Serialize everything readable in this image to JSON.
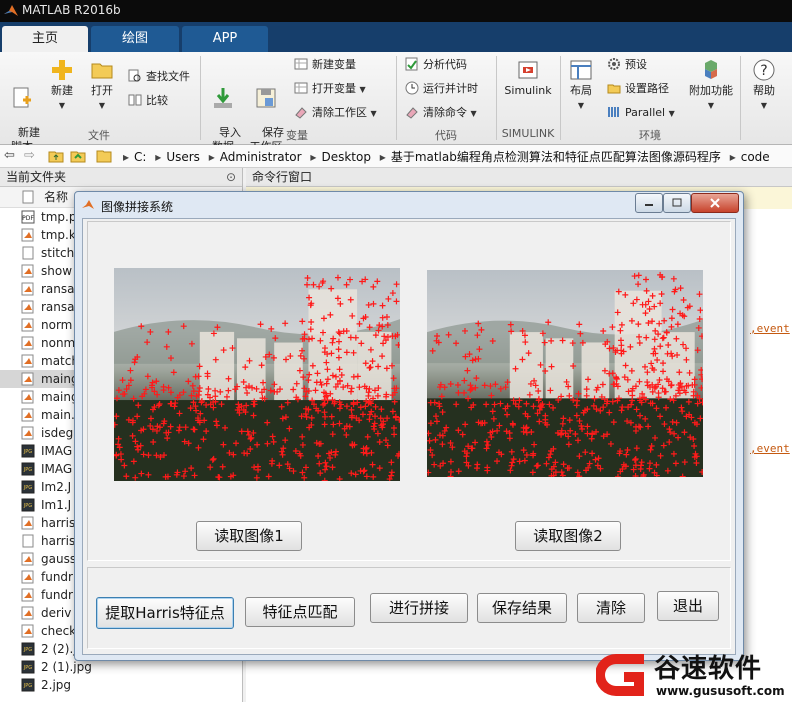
{
  "window": {
    "title": "MATLAB R2016b"
  },
  "tabs": [
    {
      "label": "主页"
    },
    {
      "label": "绘图"
    },
    {
      "label": "APP"
    }
  ],
  "ribbon": {
    "file": {
      "group": "文件",
      "new_script": "新建\n脚本",
      "new": "新建",
      "open": "打开",
      "find_files": "查找文件",
      "compare": "比较"
    },
    "variable": {
      "group": "变量",
      "import": "导入\n数据",
      "save": "保存\n工作区",
      "new_var": "新建变量",
      "open_var": "打开变量",
      "clear_ws": "清除工作区"
    },
    "code": {
      "group": "代码",
      "analyze": "分析代码",
      "run_time": "运行并计时",
      "clear_cmd": "清除命令"
    },
    "simulink": {
      "group": "SIMULINK",
      "label": "Simulink"
    },
    "env": {
      "group": "环境",
      "layout": "布局",
      "prefs": "预设",
      "set_path": "设置路径",
      "parallel": "Parallel",
      "addons": "附加功能"
    },
    "help": {
      "label": "帮助"
    }
  },
  "address": {
    "segments": [
      "C:",
      "Users",
      "Administrator",
      "Desktop",
      "基于matlab编程角点检测算法和特征点匹配算法图像源码程序",
      "code"
    ]
  },
  "current_folder": {
    "title": "当前文件夹",
    "column": "名称",
    "files": [
      {
        "name": "tmp.pdf",
        "icon": "pdf"
      },
      {
        "name": "tmp.ki",
        "icon": "m"
      },
      {
        "name": "stitch",
        "icon": "doc"
      },
      {
        "name": "show",
        "icon": "m"
      },
      {
        "name": "ransa",
        "icon": "m"
      },
      {
        "name": "ransa",
        "icon": "m"
      },
      {
        "name": "norm",
        "icon": "m"
      },
      {
        "name": "nonm",
        "icon": "m"
      },
      {
        "name": "match",
        "icon": "m"
      },
      {
        "name": "maing",
        "icon": "m",
        "selected": true
      },
      {
        "name": "maing",
        "icon": "m"
      },
      {
        "name": "main.f",
        "icon": "m"
      },
      {
        "name": "isdeg",
        "icon": "m"
      },
      {
        "name": "IMAG",
        "icon": "jpg"
      },
      {
        "name": "IMAG",
        "icon": "jpg"
      },
      {
        "name": "Im2.J",
        "icon": "jpg"
      },
      {
        "name": "Im1.J",
        "icon": "jpg"
      },
      {
        "name": "harris",
        "icon": "m"
      },
      {
        "name": "harris",
        "icon": "doc"
      },
      {
        "name": "gauss",
        "icon": "m"
      },
      {
        "name": "fundr",
        "icon": "m"
      },
      {
        "name": "fundr",
        "icon": "m"
      },
      {
        "name": "deriv",
        "icon": "m"
      },
      {
        "name": "check",
        "icon": "m"
      },
      {
        "name": "2 (2).jpg",
        "icon": "jpg"
      },
      {
        "name": "2 (1).jpg",
        "icon": "jpg"
      },
      {
        "name": "2.jpg",
        "icon": "jpg"
      }
    ]
  },
  "command_window": {
    "title": "命令行窗口",
    "links": [
      ",event",
      ",event"
    ]
  },
  "dialog": {
    "title": "图像拼接系统",
    "read_img1": "读取图像1",
    "read_img2": "读取图像2",
    "extract_harris": "提取Harris特征点",
    "match_points": "特征点匹配",
    "stitch": "进行拼接",
    "save_result": "保存结果",
    "clear": "清除",
    "exit": "退出"
  },
  "watermark": {
    "brand": "谷速软件",
    "url": "www.gususoft.com"
  }
}
